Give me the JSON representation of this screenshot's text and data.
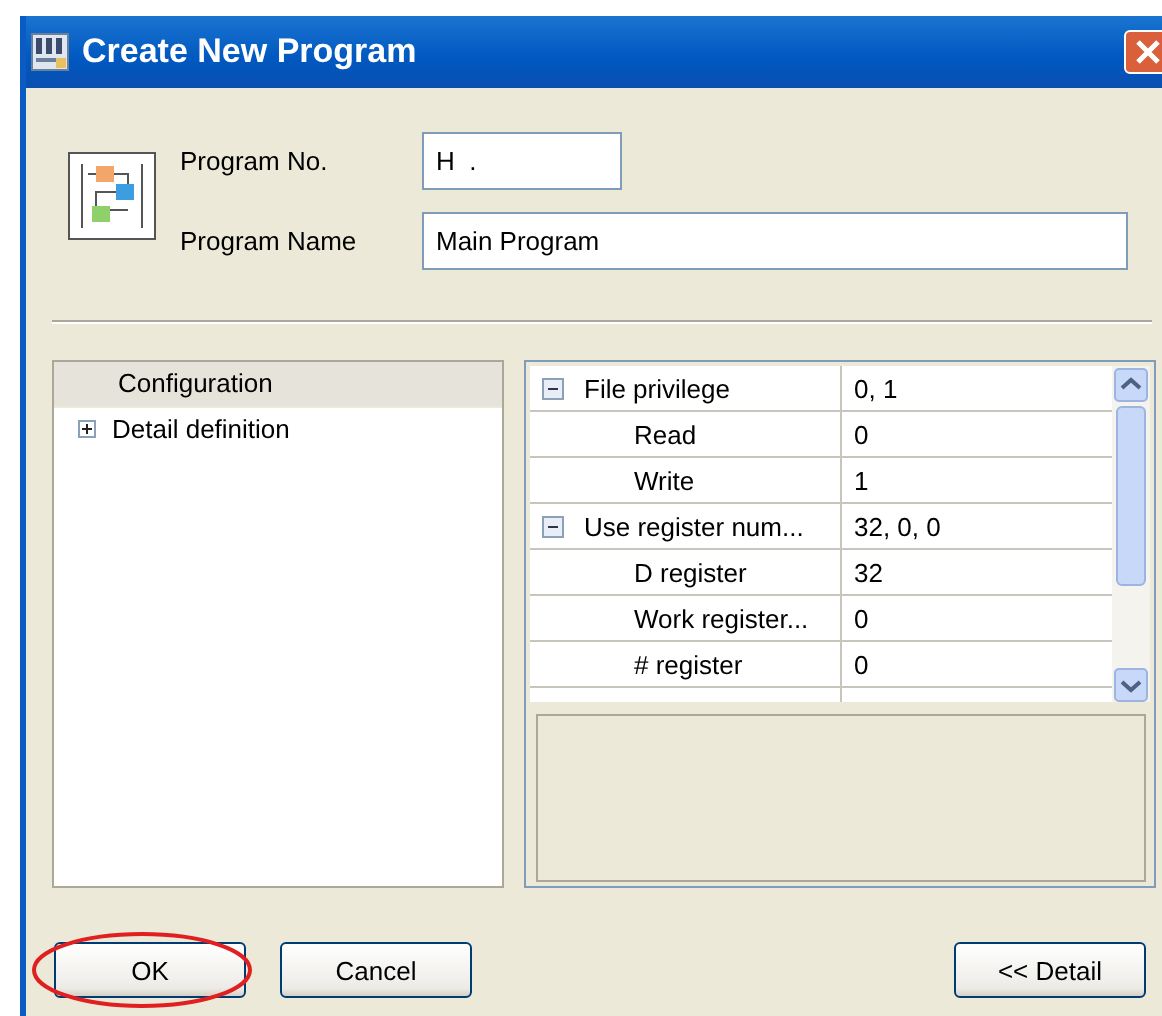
{
  "window": {
    "title": "Create New Program"
  },
  "fields": [
    {
      "label": "Program No.",
      "value": "H  ."
    },
    {
      "label": "Program Name",
      "value": "Main Program"
    }
  ],
  "tree": {
    "header": "Configuration",
    "items": [
      {
        "label": "Detail definition",
        "expanded": false
      }
    ]
  },
  "properties": [
    {
      "name": "File privilege",
      "value": "0, 1",
      "expanded": true,
      "children": [
        {
          "name": "Read",
          "value": "0"
        },
        {
          "name": "Write",
          "value": "1"
        }
      ]
    },
    {
      "name": "Use register num...",
      "value": "32, 0, 0",
      "expanded": true,
      "children": [
        {
          "name": "D register",
          "value": "32"
        },
        {
          "name": "Work register...",
          "value": "0"
        },
        {
          "name": "# register",
          "value": "0"
        }
      ]
    }
  ],
  "buttons": [
    {
      "label": "OK",
      "highlighted": true
    },
    {
      "label": "Cancel",
      "highlighted": false
    },
    {
      "label": "<< Detail",
      "highlighted": false
    }
  ]
}
